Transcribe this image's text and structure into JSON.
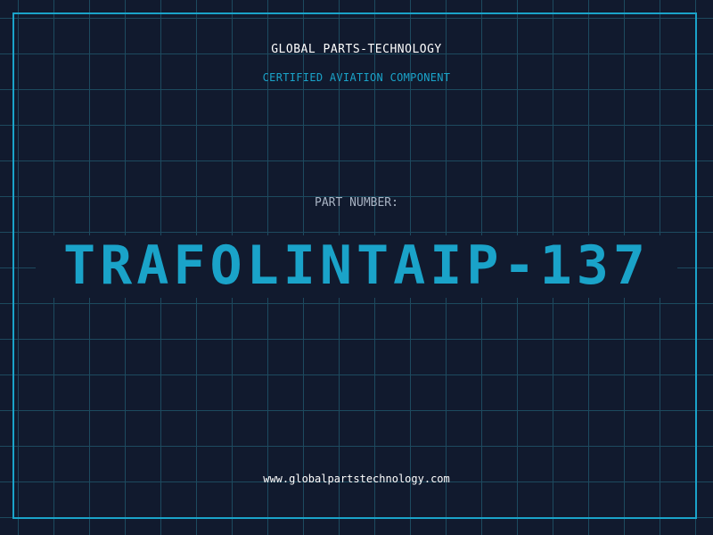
{
  "company_name": "GLOBAL PARTS-TECHNOLOGY",
  "tagline": "CERTIFIED AVIATION COMPONENT",
  "part_label": "PART NUMBER:",
  "part_number": "TRAFOLINTAIP-137",
  "website": "www.globalpartstechnology.com",
  "colors": {
    "background": "#111a2e",
    "grid": "#1d4a5f",
    "accent": "#1aa3c9",
    "label": "#a9b4c4",
    "text": "#ffffff"
  }
}
